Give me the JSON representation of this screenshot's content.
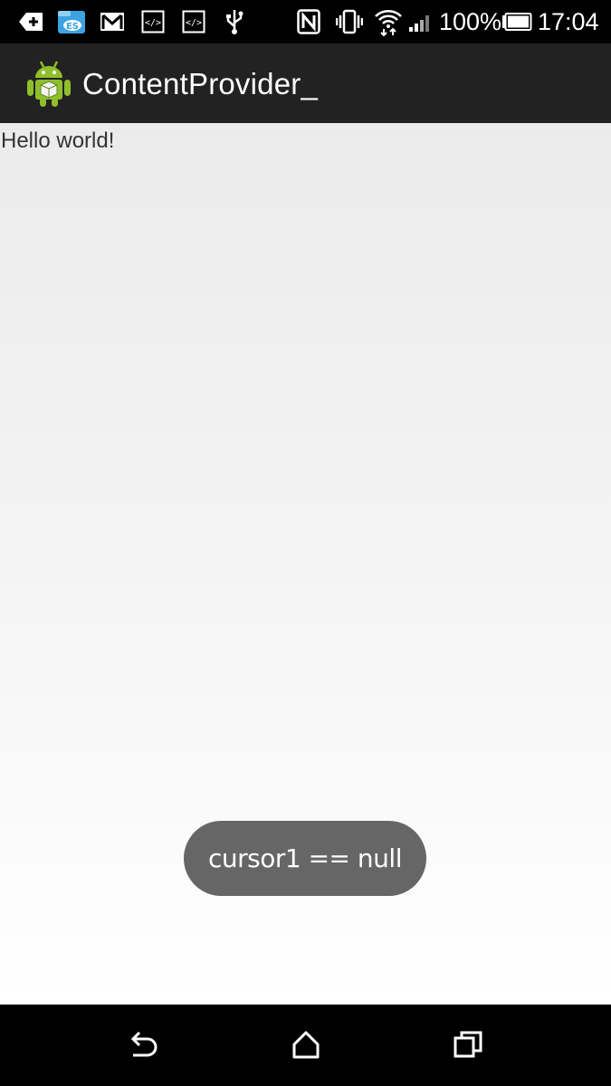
{
  "status_bar": {
    "icons": [
      "add-notification-icon",
      "file-manager-icon",
      "gmail-icon",
      "code-icon",
      "code-icon",
      "usb-icon",
      "nfc-icon",
      "vibrate-icon",
      "wifi-icon",
      "signal-icon",
      "battery-icon"
    ],
    "battery_text": "100%",
    "time": "17:04"
  },
  "action_bar": {
    "app_icon": "android-icon",
    "title": "ContentProvider_"
  },
  "content": {
    "text": "Hello world!"
  },
  "toast": {
    "text": "cursor1 == null"
  },
  "nav_bar": {
    "buttons": [
      "back-icon",
      "home-icon",
      "recents-icon"
    ]
  },
  "colors": {
    "status_bar_bg": "#000000",
    "action_bar_bg": "#222222",
    "toast_bg": "#666666",
    "android_green": "#8fbf2b"
  }
}
